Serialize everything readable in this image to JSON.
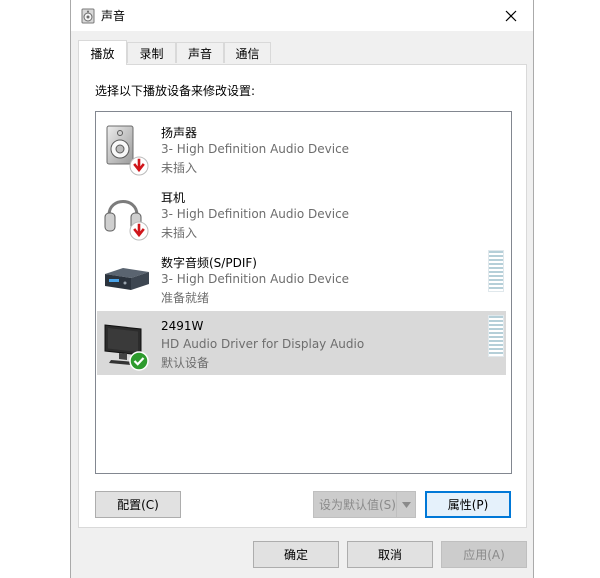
{
  "window": {
    "title": "声音",
    "close_icon": "close-icon",
    "title_icon": "speaker-icon"
  },
  "tabs": [
    {
      "label": "播放",
      "active": true
    },
    {
      "label": "录制",
      "active": false
    },
    {
      "label": "声音",
      "active": false
    },
    {
      "label": "通信",
      "active": false
    }
  ],
  "panel": {
    "instruction": "选择以下播放设备来修改设置:"
  },
  "devices": [
    {
      "name": "扬声器",
      "driver": "3- High Definition Audio Device",
      "status": "未插入",
      "icon": "speaker-icon",
      "badge": "unplugged-arrow-icon",
      "selected": false,
      "meter": false
    },
    {
      "name": "耳机",
      "driver": "3- High Definition Audio Device",
      "status": "未插入",
      "icon": "headphones-icon",
      "badge": "unplugged-arrow-icon",
      "selected": false,
      "meter": false
    },
    {
      "name": "数字音频(S/PDIF)",
      "driver": "3- High Definition Audio Device",
      "status": "准备就绪",
      "icon": "digital-audio-icon",
      "badge": "",
      "selected": false,
      "meter": true
    },
    {
      "name": "2491W",
      "driver": "HD Audio Driver for Display Audio",
      "status": "默认设备",
      "icon": "monitor-icon",
      "badge": "default-check-icon",
      "selected": true,
      "meter": true
    }
  ],
  "buttons": {
    "configure": "配置(C)",
    "set_default": "设为默认值(S)",
    "properties": "属性(P)",
    "ok": "确定",
    "cancel": "取消",
    "apply": "应用(A)"
  },
  "colors": {
    "accent": "#0078d7",
    "check_green": "#2e9b2e",
    "unplugged_red": "#d0161b",
    "selected_row": "#d9d9d9"
  }
}
